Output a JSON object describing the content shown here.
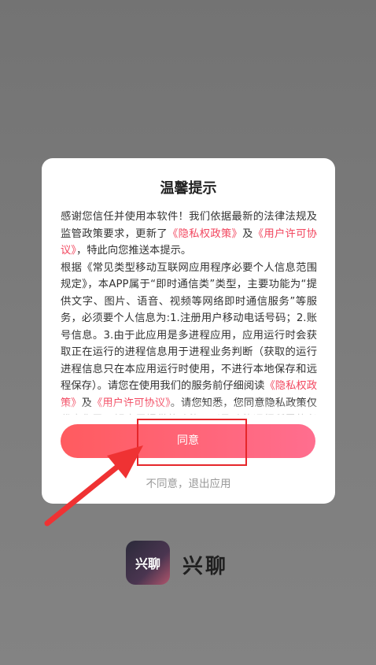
{
  "dialog": {
    "title": "温馨提示",
    "p1_a": "感谢您信任并使用本软件！我们依据最新的法律法规及监管政策要求，更新了",
    "p1_link1": "《隐私权政策》",
    "p1_b": "及",
    "p1_link2": "《用户许可协议》",
    "p1_c": "，特此向您推送本提示。",
    "p2_a": "根据《常见类型移动互联网应用程序必要个人信息范围规定》，本APP属于“即时通信类”类型，主要功能为“提供文字、图片、语音、视频等网络即时通信服务”等服务，必须要个人信息为:1.注册用户移动电话号码；2.账号信息。3.由于此应用是多进程应用，应用运行时会获取正在运行的进程信息用于进程业务判断（获取的运行进程信息只在本应用运行时使用，不进行本地保存和远程保存）。请您在使用我们的服务前仔细阅读",
    "p2_link1": "《隐私权政策》",
    "p2_b": "及",
    "p2_link2": "《用户许可协议》",
    "p2_c": "。请您知悉，您同意隐私政策仅代表您已了解应用提供的功能，以及功能运行所需的必要个人信息，并不代表您已同意我们可以收集非必要个人信息。",
    "agree_label": "同意",
    "disagree_label": "不同意，退出应用"
  },
  "app": {
    "name": "兴聊",
    "icon_text": "兴聊"
  },
  "colors": {
    "link": "#f2475f",
    "button_start": "#ff5b5f",
    "button_end": "#ff6e8f",
    "annotation": "#e5262a"
  }
}
